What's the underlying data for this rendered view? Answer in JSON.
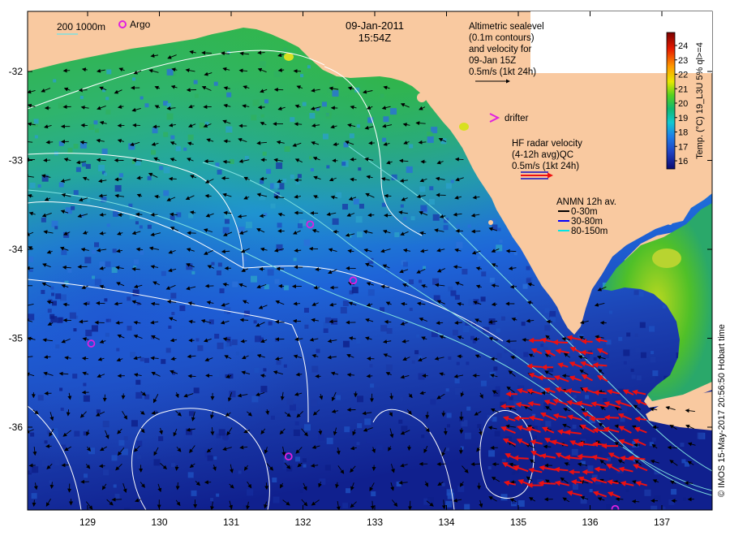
{
  "header": {
    "date": "09-Jan-2011",
    "time": "15:54Z"
  },
  "legend": {
    "isobath_label": "200  1000m",
    "argo_label": "Argo",
    "altimetry_text": [
      "Altimetric sealevel",
      "(0.1m contours)",
      "and velocity for",
      "09-Jan 15Z",
      "0.5m/s (1kt 24h)"
    ],
    "drifter_label": "drifter",
    "hf_radar_text": [
      "HF radar velocity",
      "(4-12h avg)QC",
      "0.5m/s (1kt 24h)"
    ],
    "anmn_title": "ANMN 12h av.",
    "anmn_items": [
      {
        "label": "0-30m",
        "color": "#000000"
      },
      {
        "label": "30-80m",
        "color": "#0000ff"
      },
      {
        "label": "80-150m",
        "color": "#00e5e5"
      }
    ]
  },
  "colorbar": {
    "title": "Temp. (°C) 19_L3U 5% ql>=4",
    "ticks": [
      "24",
      "23",
      "22",
      "21",
      "20",
      "19",
      "18",
      "17",
      "16"
    ]
  },
  "axes": {
    "x_ticks": [
      "129",
      "130",
      "131",
      "132",
      "133",
      "134",
      "135",
      "136",
      "137"
    ],
    "y_ticks": [
      "-32",
      "-33",
      "-34",
      "-35",
      "-36"
    ]
  },
  "credit": "© IMOS 15-May-2017 20:56:50 Hobart time",
  "argo_floats": [
    {
      "lon": 132.1,
      "lat": -33.72
    },
    {
      "lon": 132.7,
      "lat": -34.35
    },
    {
      "lon": 129.05,
      "lat": -35.06
    },
    {
      "lon": 131.8,
      "lat": -36.33
    },
    {
      "lon": 136.35,
      "lat": -36.92
    }
  ],
  "colors": {
    "land": "#f9c9a0",
    "hf_radar": "#ee1010",
    "argo": "#e020e0",
    "isobath": "#7fe0e0",
    "contour": "#ffffff"
  }
}
